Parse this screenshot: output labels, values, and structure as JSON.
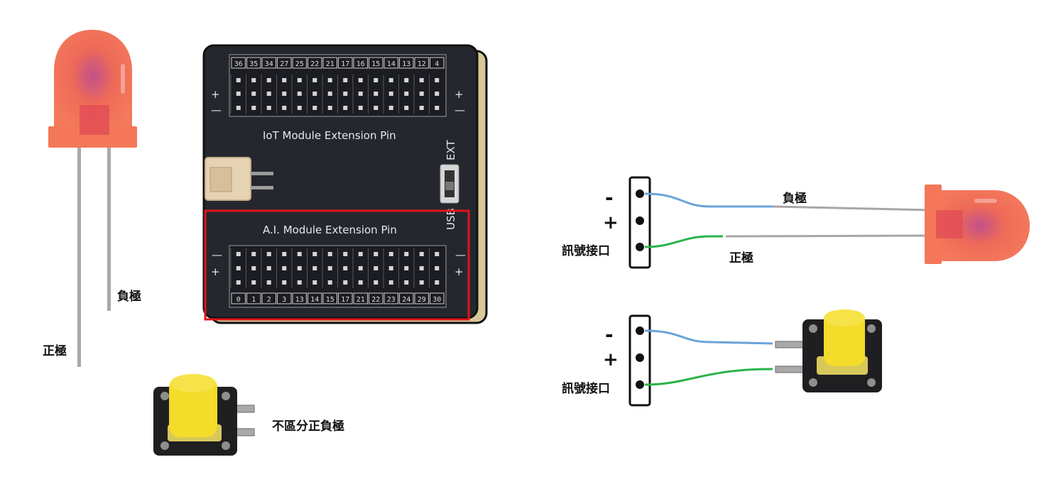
{
  "board": {
    "iot_title": "IoT Module Extension Pin",
    "ai_title": "A.I. Module Extension Pin",
    "iot_pins": [
      "36",
      "35",
      "34",
      "27",
      "25",
      "22",
      "21",
      "17",
      "16",
      "15",
      "14",
      "13",
      "12",
      "4"
    ],
    "ai_pins": [
      "0",
      "1",
      "2",
      "3",
      "13",
      "14",
      "15",
      "17",
      "21",
      "22",
      "23",
      "24",
      "29",
      "30"
    ],
    "plus": "+",
    "minus": "—",
    "switch_top": "EXT",
    "switch_bottom": "USB"
  },
  "led_left": {
    "negative_label": "負極",
    "positive_label": "正極"
  },
  "button_left": {
    "label": "不區分正負極"
  },
  "wiring_led": {
    "minus_sign": "-",
    "plus_sign": "+",
    "signal_label": "訊號接口",
    "negative_label": "負極",
    "positive_label": "正極"
  },
  "wiring_button": {
    "minus_sign": "-",
    "plus_sign": "+",
    "signal_label": "訊號接口"
  },
  "colors": {
    "led": "#f26a55",
    "board": "#25272e",
    "highlight": "#e0141a",
    "button_cap": "#f3dc2a",
    "wire_negative": "#6aa3d8",
    "wire_signal": "#2bb34a",
    "board_edge": "#d9c79a"
  }
}
